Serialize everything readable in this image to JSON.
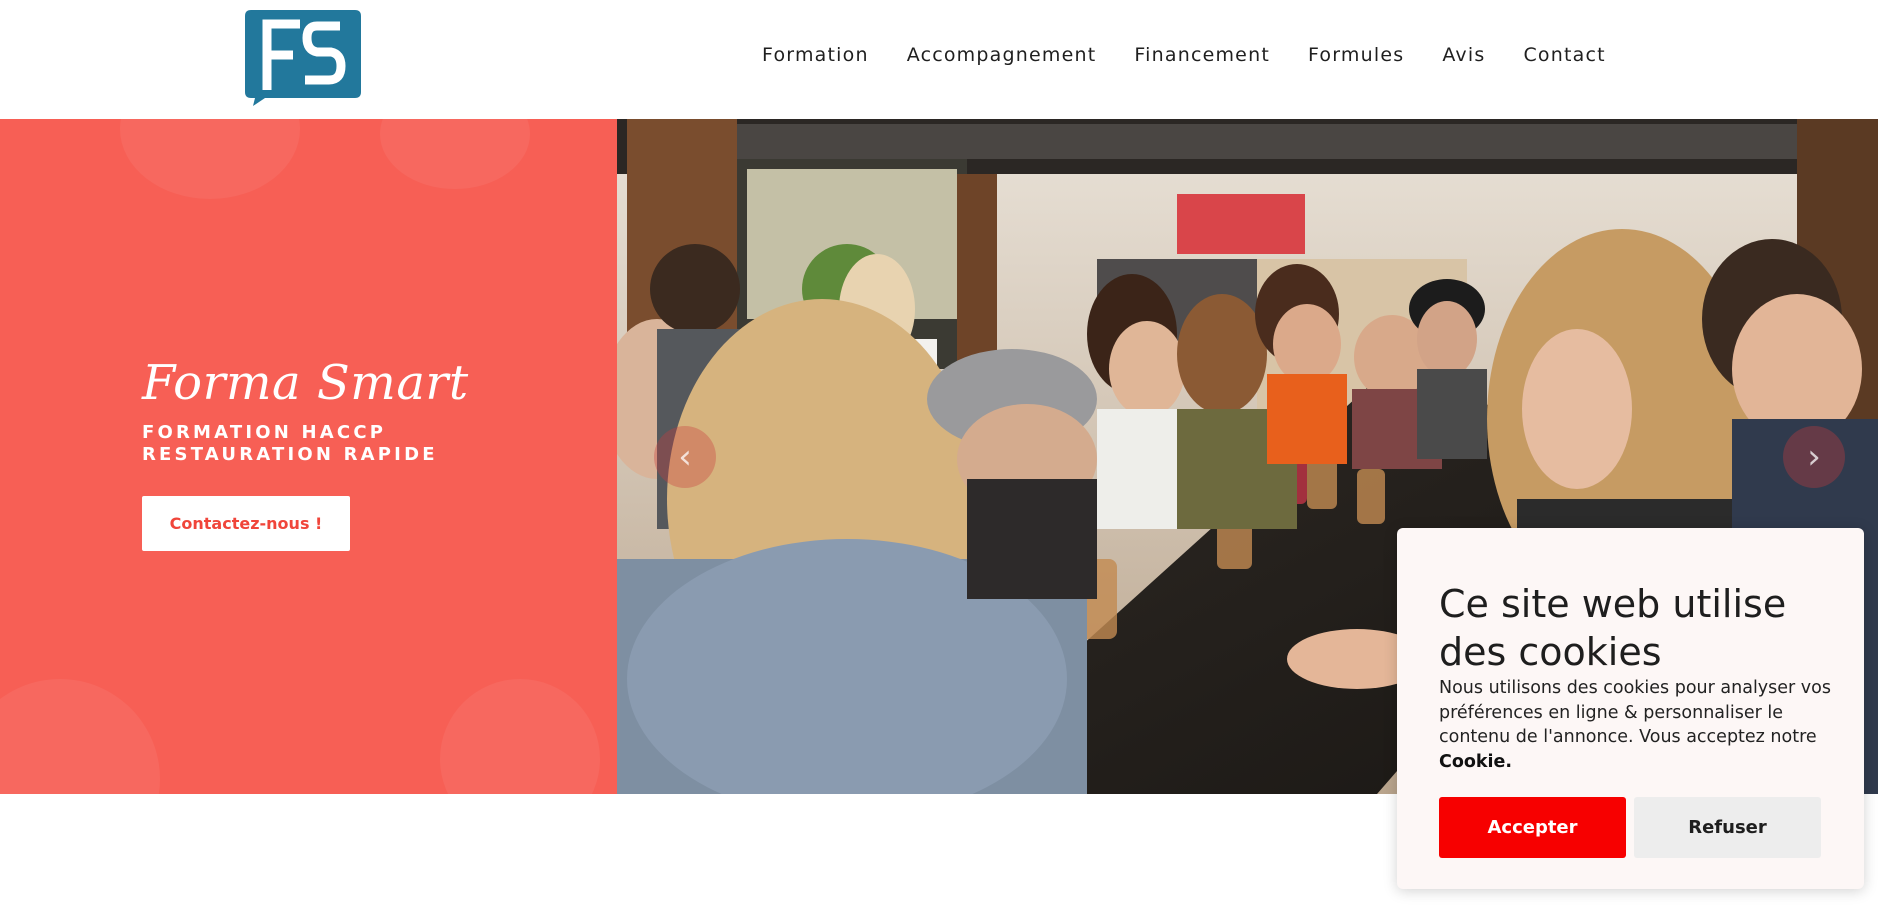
{
  "header": {
    "logo_text": "FS",
    "logo_color": "#22789c",
    "nav": [
      {
        "label": "Formation"
      },
      {
        "label": "Accompagnement"
      },
      {
        "label": "Financement"
      },
      {
        "label": "Formules"
      },
      {
        "label": "Avis"
      },
      {
        "label": "Contact"
      }
    ]
  },
  "hero": {
    "brand": "Forma Smart",
    "subtitle_line1": "FORMATION HACCP",
    "subtitle_line2": "RESTAURATION RAPIDE",
    "cta_label": "Contactez-nous !",
    "panel_color": "#f75f55",
    "prev_arrow": "‹",
    "next_arrow": "›",
    "photo_icon": "restaurant-group-photo"
  },
  "cookie": {
    "title": "Ce site web utilise des cookies",
    "text": "Nous utilisons des cookies pour analyser vos préférences en ligne & personnaliser le contenu de l'annonce. Vous acceptez notre",
    "text_bold": "Cookie.",
    "accept_label": "Accepter",
    "refuse_label": "Refuser",
    "accept_color": "#f70000"
  }
}
